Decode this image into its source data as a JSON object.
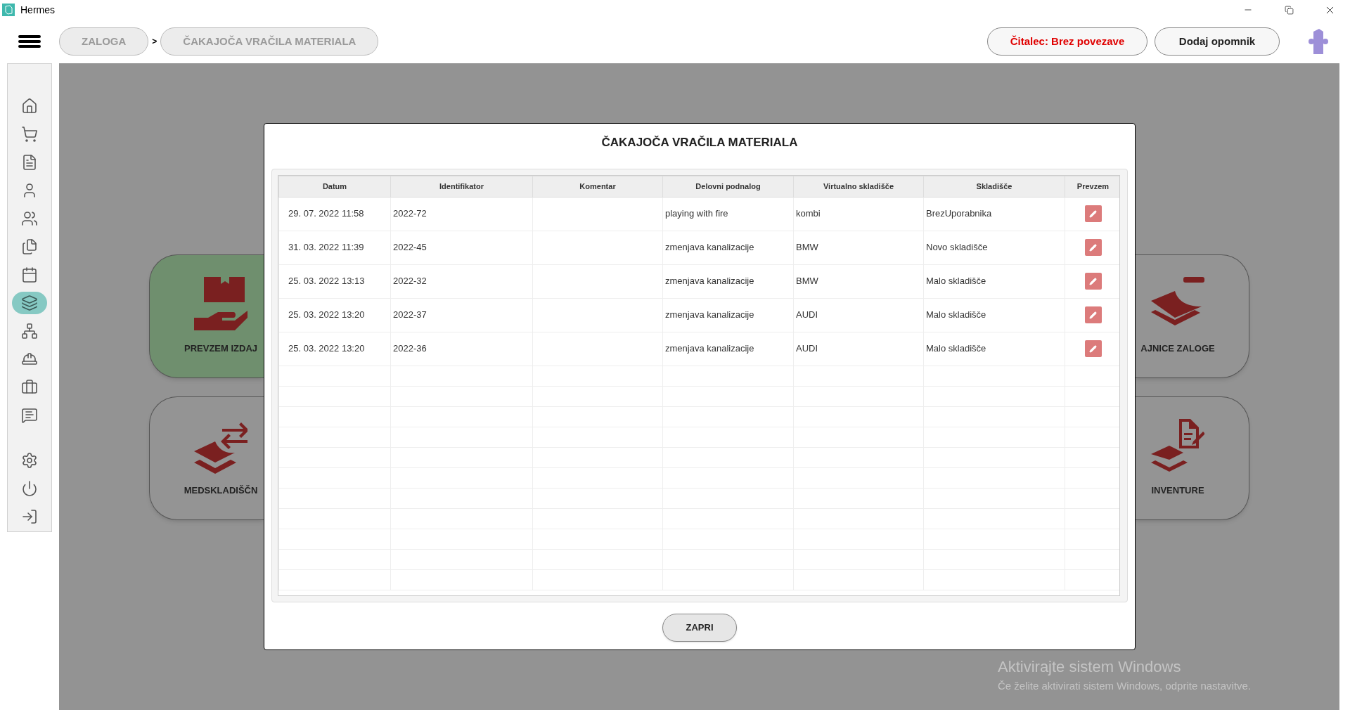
{
  "window": {
    "title": "Hermes"
  },
  "breadcrumbs": {
    "items": [
      "ZALOGA",
      "ČAKAJOČA VRAČILA MATERIALA"
    ],
    "separator": ">"
  },
  "header_buttons": [
    {
      "label": "Čitalec: Brez povezave",
      "kind": "warning"
    },
    {
      "label": "Dodaj opomnik",
      "kind": "normal"
    }
  ],
  "sidebar": {
    "items": [
      {
        "selected": false
      },
      {
        "selected": false
      },
      {
        "selected": false
      },
      {
        "selected": false
      },
      {
        "selected": false
      },
      {
        "selected": false
      },
      {
        "selected": false
      },
      {
        "selected": true
      },
      {
        "selected": false
      },
      {
        "selected": false
      },
      {
        "selected": false
      },
      {
        "selected": false
      },
      {
        "selected": false
      },
      {
        "selected": false
      },
      {
        "selected": false
      }
    ]
  },
  "tiles": [
    {
      "label": "PREVZEM IZDAJ",
      "kind": "left",
      "highlighted": true
    },
    {
      "label": "MEDSKLADIŠČN",
      "kind": "left",
      "highlighted": false
    },
    {
      "label": "AJNICE ZALOGE",
      "kind": "right",
      "highlighted": false
    },
    {
      "label": "INVENTURE",
      "kind": "right",
      "highlighted": false
    }
  ],
  "dialog": {
    "title": "ČAKAJOČA VRAČILA MATERIALA",
    "table": {
      "columns": [
        "Datum",
        "Identifikator",
        "Komentar",
        "Delovni podnalog",
        "Virtualno skladišče",
        "Skladišče",
        "Prevzem"
      ],
      "rows": [
        {
          "datum": "29. 07. 2022 11:58",
          "identifikator": "2022-72",
          "delovni_podnalog": "playing with fire",
          "virtualno_skladisce": "kombi",
          "skladisce": "BrezUporabnika"
        },
        {
          "datum": "31. 03. 2022 11:39",
          "identifikator": "2022-45",
          "delovni_podnalog": "zmenjava kanalizacije",
          "virtualno_skladisce": "BMW",
          "skladisce": "Novo skladišče"
        },
        {
          "datum": "25. 03. 2022 13:13",
          "identifikator": "2022-32",
          "delovni_podnalog": "zmenjava kanalizacije",
          "virtualno_skladisce": "BMW",
          "skladisce": "Malo skladišče"
        },
        {
          "datum": "25. 03. 2022 13:20",
          "identifikator": "2022-37",
          "delovni_podnalog": "zmenjava kanalizacije",
          "virtualno_skladisce": "AUDI",
          "skladisce": "Malo skladišče"
        },
        {
          "datum": "25. 03. 2022 13:20",
          "identifikator": "2022-36",
          "delovni_podnalog": "zmenjava kanalizacije",
          "virtualno_skladisce": "AUDI",
          "skladisce": "Malo skladišče"
        }
      ]
    },
    "close_button": "ZAPRI"
  },
  "activation_notice": {
    "title": "Aktivirajte sistem Windows",
    "text": "Če želite aktivirati sistem Windows, odprite nastavitve."
  }
}
